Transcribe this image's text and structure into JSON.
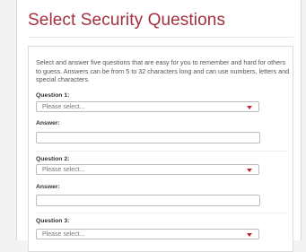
{
  "page": {
    "title": "Select Security Questions"
  },
  "intro": {
    "text": "Select and answer five questions that are easy for you to remember and hard for others to guess. Answers can be from 5 to 32 characters long and can use numbers, letters and special characters."
  },
  "questions": [
    {
      "label": "Question 1:",
      "select_value": "Please select...",
      "answer_label": "Answer:",
      "answer_value": ""
    },
    {
      "label": "Question 2:",
      "select_value": "Please select...",
      "answer_label": "Answer:",
      "answer_value": ""
    },
    {
      "label": "Question 3:",
      "select_value": "Please select..."
    }
  ],
  "colors": {
    "title": "#a3313d",
    "caret": "#c0262d"
  },
  "icons": [
    "chevron-down-icon"
  ]
}
